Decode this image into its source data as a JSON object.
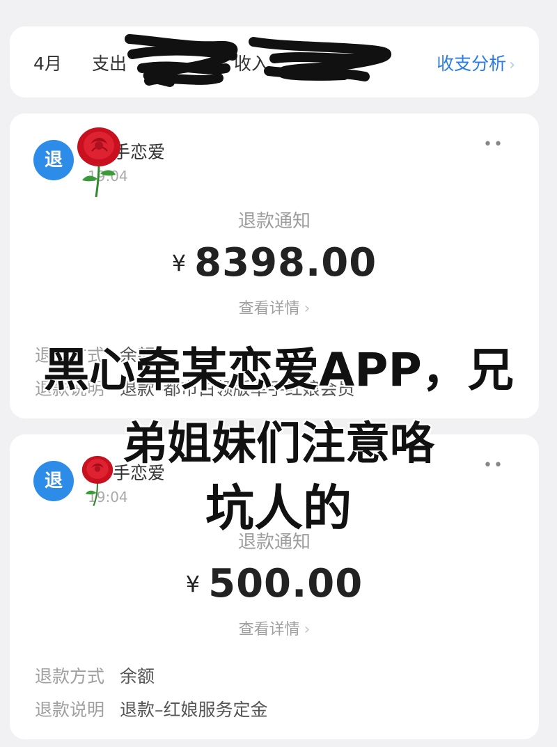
{
  "summary": {
    "month": "4月",
    "expense_label": "支出",
    "income_label": "收入",
    "analysis_link": "收支分析",
    "chevron": "〉"
  },
  "transactions": [
    {
      "badge": "退",
      "merchant": "手恋爱",
      "time": "19:04",
      "title": "退款通知",
      "currency": "¥",
      "amount": "8398.00",
      "detail_link": "查看详情",
      "method_label": "退款方式",
      "method_value": "余额",
      "note_label": "退款说明",
      "note_value": "退款–都市白领版牵手红娘会员"
    },
    {
      "badge": "退",
      "merchant": "手恋爱",
      "time": "19:04",
      "title": "退款通知",
      "currency": "¥",
      "amount": "500.00",
      "detail_link": "查看详情",
      "method_label": "退款方式",
      "method_value": "余额",
      "note_label": "退款说明",
      "note_value": "退款–红娘服务定金"
    }
  ],
  "overlay_text": {
    "line1": "黑心牵某恋爱APP，兄",
    "line2": "弟姐妹们注意咯",
    "line3": "坑人的"
  },
  "colors": {
    "accent_blue": "#2a7de0",
    "badge_blue": "#2d8ce8",
    "rose_red": "#d8172b"
  },
  "icons": {
    "badge": "refund-badge-icon",
    "rose": "rose-icon",
    "more": "more-dots-icon",
    "chevron": "chevron-right-icon"
  }
}
